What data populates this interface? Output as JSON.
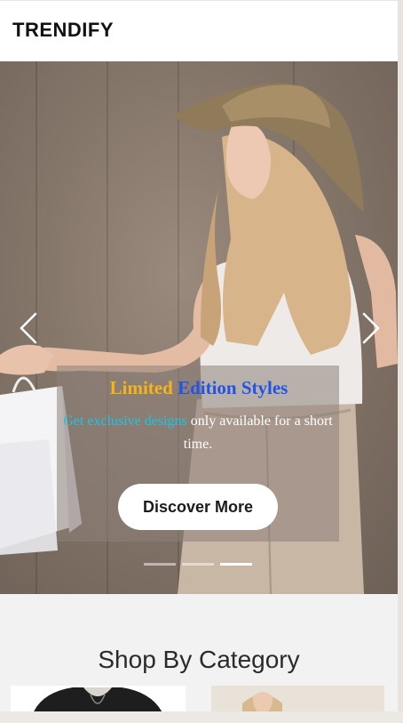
{
  "header": {
    "brand": "TRENDIFY"
  },
  "hero": {
    "title_word_1": "Limited",
    "title_word_2": "Edition Styles",
    "text_highlight": "Get exclusive designs",
    "text_rest": " only available for a short time.",
    "button_label": "Discover More",
    "slides_total": 3,
    "active_slide": 3
  },
  "categories": {
    "title": "Shop By Category"
  },
  "colors": {
    "title_word_1": "#f6b418",
    "title_word_2": "#2154e6",
    "text_highlight": "#1ac6e4"
  }
}
